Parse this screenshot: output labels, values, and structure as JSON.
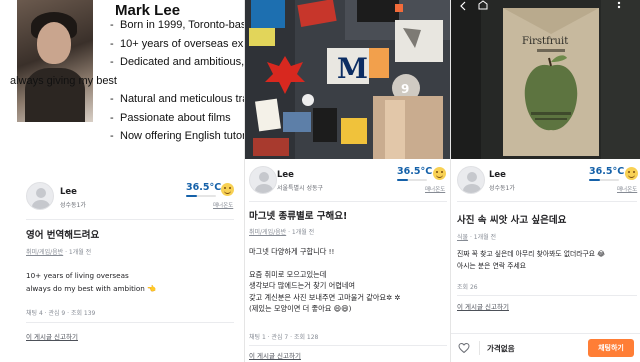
{
  "panels": [
    {
      "resume": {
        "name": "Mark Lee",
        "bullets": [
          "Born in 1999, Toronto-bas",
          "10+ years of overseas expe",
          "Dedicated and ambitious,",
          "always giving my best",
          "Natural and meticulous tra",
          "Passionate about films",
          "Now offering English tutori"
        ]
      },
      "profile": {
        "nickname": "Lee",
        "region": "성수동1가",
        "temperature": "36.5°C",
        "temperature_level": 0.365,
        "manner_label": "매너온도"
      },
      "post": {
        "title": "영어 번역해드려요",
        "category": "취미/게임/음반",
        "time": "1개월 전",
        "body_lines": [
          "10+ years of living overseas",
          "always do my best with ambition 👈"
        ],
        "stats": "채팅 4 · 관심 9 · 조회 139",
        "report": "이 게시글 신고하기"
      }
    },
    {
      "profile": {
        "nickname": "Lee",
        "region": "서울특별시 성동구",
        "temperature": "36.5°C",
        "temperature_level": 0.365,
        "manner_label": "매너온도"
      },
      "post": {
        "title": "마그넷 종류별로 구해요!",
        "category": "취미/게임/음반",
        "time": "1개월 전",
        "body_lines": [
          "마그넷 다양하게 구합니다 !!",
          "",
          "요즘 취미로 모으고있는데",
          "생각보다 많에드는거 찾기 어렵네여",
          "갖고 계신분은 사진 보내주면 고마울거 같아요✲ ✲",
          "(제있는 모양이면 더 좋아요 😄😄)"
        ],
        "stats": "채팅 1 · 관심 7 · 조회 128",
        "report": "이 게시글 신고하기"
      },
      "hero_text": {
        "magnet_m": "M",
        "magnet_number": "9"
      }
    },
    {
      "profile": {
        "nickname": "Lee",
        "region": "성수동1가",
        "temperature": "36.5°C",
        "temperature_level": 0.365,
        "manner_label": "매너온도"
      },
      "post": {
        "title": "사진 속 씨앗 사고 싶은데요",
        "category": "식물",
        "time": "1개월 전",
        "body_lines": [
          "진짜 꼭 찾고 싶은데 아무리 찾아봐도 없더라구요 😂",
          "아시는 분은 연락 주세요"
        ],
        "stats": "조회 26",
        "report": "이 게시글 신고하기"
      },
      "hero_text": {
        "packet_title": "Firstfruit"
      },
      "bottom_bar": {
        "price": "가격없음",
        "chat_button": "채팅하기"
      }
    }
  ]
}
